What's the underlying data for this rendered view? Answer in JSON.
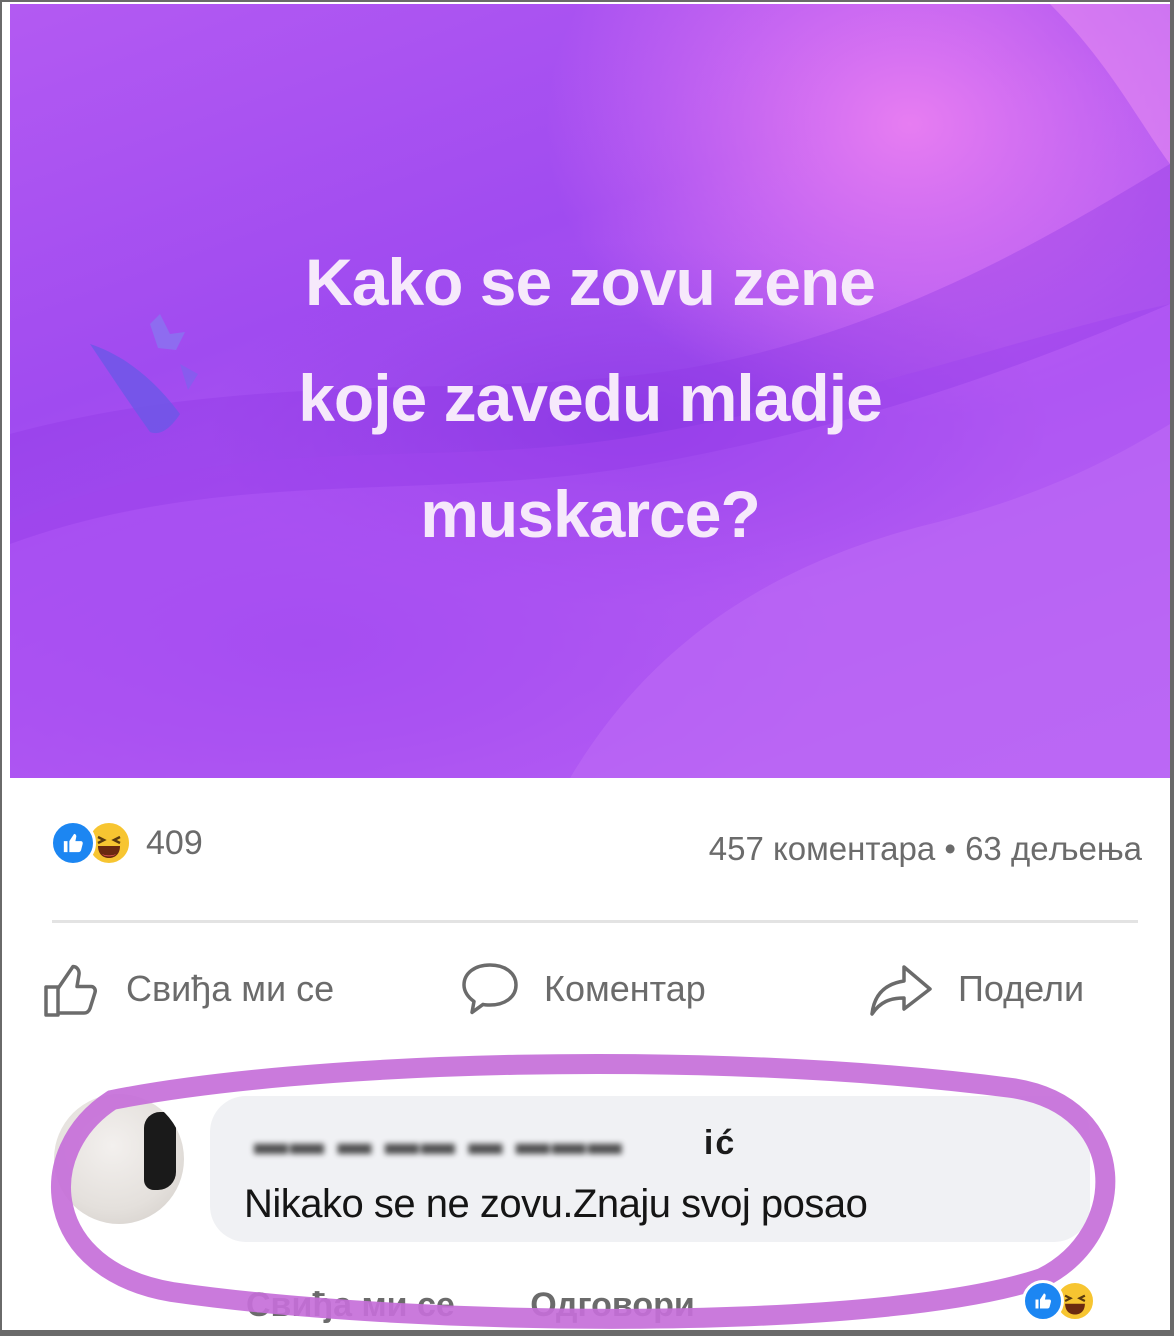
{
  "post": {
    "lines": [
      "Kako se zovu zene",
      "koje zavedu mladje",
      "muskarce?"
    ],
    "background_color": "#a44ef0",
    "text_color": "#f6e9fb"
  },
  "stats": {
    "reaction_icons": [
      "like-icon",
      "haha-icon"
    ],
    "reaction_count": "409",
    "comments_shares": "457 коментара • 63 дељења"
  },
  "actions": {
    "like_label": "Свиђа ми се",
    "comment_label": "Коментар",
    "share_label": "Подели"
  },
  "comment": {
    "author_visible": "ić",
    "text": "Nikako se ne zovu.Znaju svoj posao",
    "like_label": "Свиђа ми се",
    "reply_label": "Одговори",
    "highlight_color": "#c56fd9"
  },
  "colors": {
    "like_blue": "#1c86f2",
    "haha_yellow": "#f7c531",
    "secondary_text": "#6b6b6b"
  }
}
